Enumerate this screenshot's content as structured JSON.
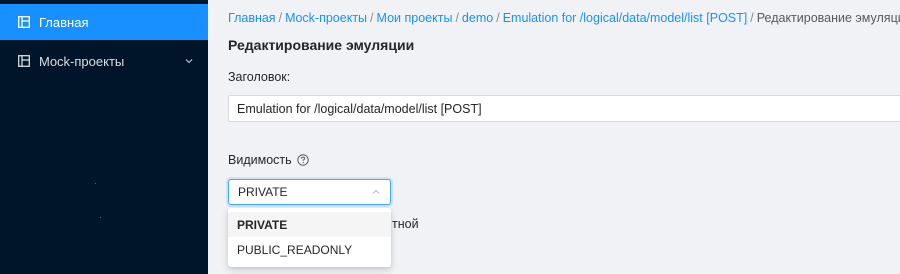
{
  "sidebar": {
    "items": [
      {
        "label": "Главная",
        "icon": "dashboard-icon"
      },
      {
        "label": "Mock-проекты",
        "icon": "project-icon"
      }
    ],
    "active_color": "#1890ff",
    "background": "#001529"
  },
  "breadcrumb": {
    "items": [
      "Главная",
      "Mock-проекты",
      "Мои проекты",
      "demo",
      "Emulation for /logical/data/model/list [POST]"
    ],
    "current": "Редактирование эмуляции",
    "separator": "/"
  },
  "page": {
    "title": "Редактирование эмуляции"
  },
  "form": {
    "title_label": "Заголовок:",
    "title_value": "Emulation for /logical/data/model/list [POST]",
    "visibility_label": "Видимость",
    "visibility_value": "PRIVATE",
    "visibility_options": [
      "PRIVATE",
      "PUBLIC_READONLY"
    ],
    "partially_hidden_text": "тной"
  },
  "colors": {
    "link": "#1890ff",
    "focus_border": "#40a9ff"
  }
}
